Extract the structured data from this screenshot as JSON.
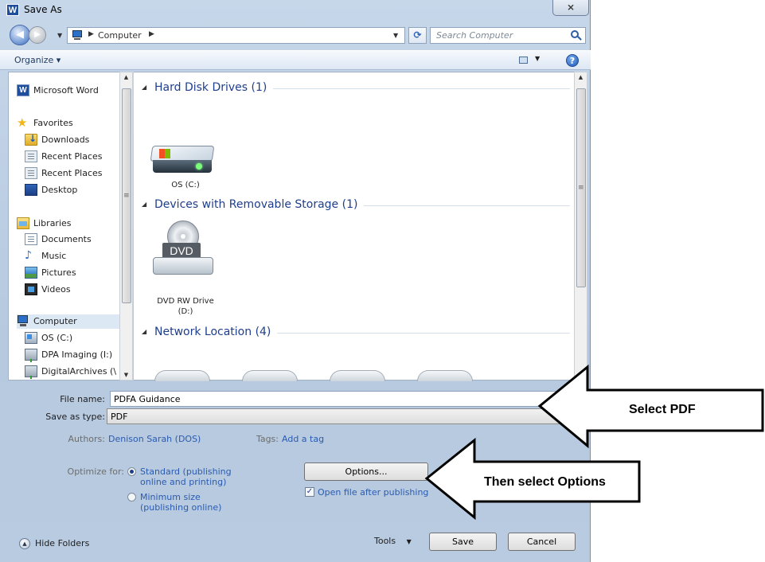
{
  "window": {
    "title": "Save As",
    "close_glyph": "⨯"
  },
  "address": {
    "path_root": "Computer",
    "search_placeholder": "Search Computer"
  },
  "toolbar": {
    "organize": "Organize ▾"
  },
  "nav": {
    "items": [
      {
        "label": "Microsoft Word",
        "icon": "word-icon"
      },
      {
        "label": "Favorites",
        "icon": "star-icon"
      },
      {
        "label": "Downloads",
        "icon": "downloads-folder-icon"
      },
      {
        "label": "Recent Places",
        "icon": "recent-places-icon"
      },
      {
        "label": "Recent Places",
        "icon": "recent-places-icon"
      },
      {
        "label": "Desktop",
        "icon": "desktop-icon"
      },
      {
        "label": "Libraries",
        "icon": "libraries-icon"
      },
      {
        "label": "Documents",
        "icon": "documents-icon"
      },
      {
        "label": "Music",
        "icon": "music-icon"
      },
      {
        "label": "Pictures",
        "icon": "pictures-icon"
      },
      {
        "label": "Videos",
        "icon": "videos-icon"
      },
      {
        "label": "Computer",
        "icon": "computer-icon"
      },
      {
        "label": "OS (C:)",
        "icon": "drive-icon"
      },
      {
        "label": "DPA Imaging (I:)",
        "icon": "network-drive-icon"
      },
      {
        "label": "DigitalArchives (\\",
        "icon": "network-drive-icon"
      }
    ]
  },
  "main": {
    "groups": [
      {
        "title": "Hard Disk Drives (1)"
      },
      {
        "title": "Devices with Removable Storage (1)"
      },
      {
        "title": "Network Location (4)"
      }
    ],
    "tiles": [
      {
        "label": "OS (C:)"
      },
      {
        "label": "DVD RW Drive",
        "sublabel": "(D:)"
      }
    ],
    "dvd_text": "DVD"
  },
  "form": {
    "file_name_label": "File name:",
    "file_name_value": "PDFA Guidance",
    "save_type_label": "Save as type:",
    "save_type_value": "PDF",
    "authors_label": "Authors:",
    "authors_value": "Denison Sarah (DOS)",
    "tags_label": "Tags:",
    "tags_value": "Add a tag",
    "optimize_label": "Optimize for:",
    "optimize_options": [
      {
        "line1": "Standard (publishing",
        "line2": "online and printing)",
        "selected": true
      },
      {
        "line1": "Minimum size",
        "line2": "(publishing online)",
        "selected": false
      }
    ],
    "options_button": "Options...",
    "open_after_label": "Open file after publishing",
    "open_after_checked": true
  },
  "footer": {
    "hide_folders": "Hide Folders",
    "tools": "Tools",
    "save": "Save",
    "cancel": "Cancel"
  },
  "annotations": {
    "callout_1": "Select PDF",
    "callout_2": "Then select Options"
  },
  "colors": {
    "link_blue": "#2a5bb0",
    "group_header_blue": "#1e3e8c"
  }
}
